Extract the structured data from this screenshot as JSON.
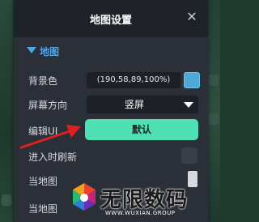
{
  "dialog": {
    "title": "地图设置",
    "close_glyph": "✕"
  },
  "section": {
    "label": "地图"
  },
  "rows": {
    "bg_color_label": "背景色",
    "bg_color_value": "(190,58,89,100%)",
    "orientation_label": "屏幕方向",
    "orientation_value": "竖屏",
    "edit_ui_label": "编辑UI",
    "default_button_label": "默认",
    "refresh_on_enter_label": "进入时刷新",
    "row6_label": "当地图",
    "row7_label": "当地图"
  },
  "watermark": {
    "title": "无限数码",
    "url": "WWW.WUXIAN.GROUP"
  },
  "colors": {
    "accent_button": "#4fe0b4",
    "section_accent": "#4ca6e8",
    "dialog_bg": "#2b2f38",
    "title_bar": "#1f2229",
    "annotation_arrow": "#e02020",
    "swatch": "#4fa8d6"
  },
  "icons": {
    "close": "close-icon",
    "section_toggle": "triangle-down-icon",
    "select_caret": "chevron-down-icon",
    "annotation": "red-arrow-icon",
    "watermark_logo": "wuxian-logo-icon"
  }
}
